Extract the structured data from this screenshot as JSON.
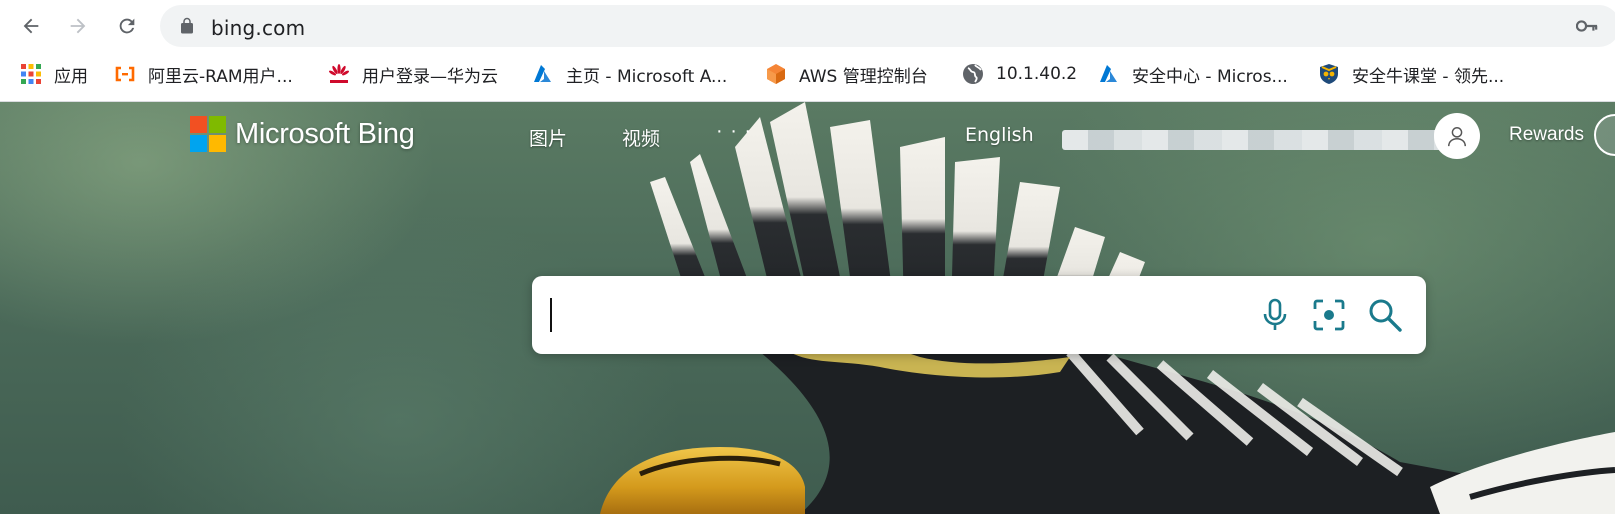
{
  "browser": {
    "url": "bing.com",
    "bookmarks": [
      {
        "label": "应用",
        "icon": "apps-grid-icon"
      },
      {
        "label": "阿里云-RAM用户...",
        "icon": "aliyun-icon"
      },
      {
        "label": "用户登录—华为云",
        "icon": "huawei-icon"
      },
      {
        "label": "主页 - Microsoft A...",
        "icon": "azure-icon"
      },
      {
        "label": "AWS 管理控制台",
        "icon": "aws-icon"
      },
      {
        "label": "10.1.40.2",
        "icon": "globe-icon"
      },
      {
        "label": "安全中心 - Micros...",
        "icon": "azure-icon"
      },
      {
        "label": "安全牛课堂 - 领先...",
        "icon": "shield-owl-icon"
      }
    ]
  },
  "bing": {
    "logo_text": "Microsoft Bing",
    "nav": {
      "images": "图片",
      "videos": "视频",
      "more": "· · ·"
    },
    "language": "English",
    "rewards": "Rewards",
    "search": {
      "value": "",
      "placeholder": ""
    }
  },
  "colors": {
    "ms_red": "#f25022",
    "ms_green": "#7fba00",
    "ms_blue": "#00a4ef",
    "ms_yellow": "#ffb900",
    "search_icon": "#1a7a8c"
  }
}
